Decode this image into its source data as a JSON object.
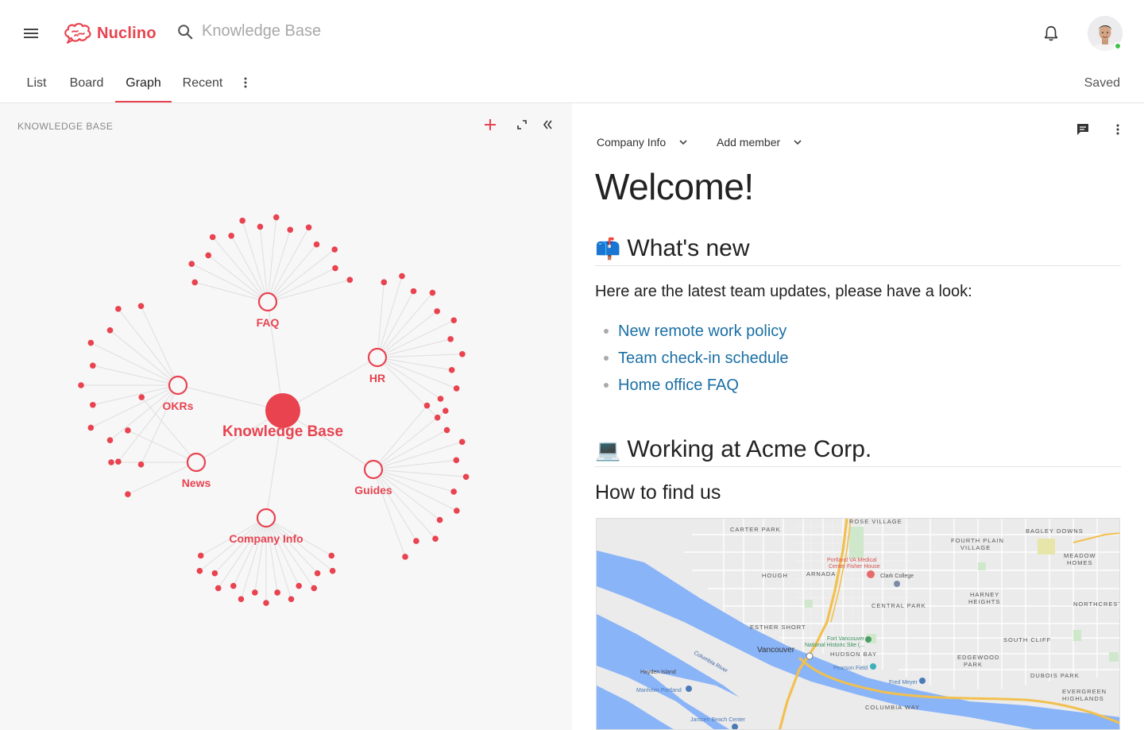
{
  "app": {
    "name": "Nuclino",
    "search_placeholder": "Knowledge Base",
    "status": "Saved",
    "brand_color": "#e8434f"
  },
  "tabs": [
    {
      "label": "List",
      "active": false
    },
    {
      "label": "Board",
      "active": false
    },
    {
      "label": "Graph",
      "active": true
    },
    {
      "label": "Recent",
      "active": false
    }
  ],
  "left_panel": {
    "title": "KNOWLEDGE BASE"
  },
  "graph": {
    "root_label": "Knowledge Base",
    "nodes": [
      {
        "label": "FAQ",
        "leaves": 14
      },
      {
        "label": "HR",
        "leaves": 12
      },
      {
        "label": "OKRs",
        "leaves": 11
      },
      {
        "label": "News",
        "leaves": 4
      },
      {
        "label": "Guides",
        "leaves": 12
      },
      {
        "label": "Company Info",
        "leaves": 15
      }
    ]
  },
  "document": {
    "workspace": "Company Info",
    "add_member": "Add member",
    "title": "Welcome!",
    "section1": {
      "emoji": "📫",
      "heading": "What's new",
      "intro": "Here are the latest team updates, please have a look:",
      "links": [
        "New remote work policy",
        "Team check-in schedule",
        "Home office FAQ"
      ]
    },
    "section2": {
      "emoji": "💻",
      "heading": "Working at Acme Corp.",
      "subheading": "How to find us"
    }
  },
  "map": {
    "labels": {
      "carter_park": "CARTER PARK",
      "rose_village": "ROSE VILLAGE",
      "bagley_downs": "BAGLEY DOWNS",
      "fourth_plain": "FOURTH PLAIN",
      "village": "VILLAGE",
      "meadow": "MEADOW",
      "homes": "HOMES",
      "hough": "HOUGH",
      "arnada": "ARNADA",
      "hospital": "Portland VA Medical",
      "hospital2": "Center Fisher House",
      "clark_college": "Clark College",
      "harney": "HARNEY",
      "heights": "HEIGHTS",
      "northcrest": "NORTHCREST",
      "central_park": "CENTRAL PARK",
      "esther_short": "ESTHER SHORT",
      "fort_vancouver": "Fort Vancouver",
      "historic": "National Historic Site (...",
      "south_cliff": "SOUTH CLIFF",
      "vancouver": "Vancouver",
      "hudson_bay": "HUDSON BAY",
      "edgewood": "EDGEWOOD",
      "park": "PARK",
      "pearson": "Pearson Field",
      "hayden": "Hayden Island",
      "manheim": "Manheim Portland",
      "dubois": "DUBOIS PARK",
      "fred_meyer": "Fred Meyer",
      "evergreen": "EVERGREEN",
      "highlands": "HIGHLANDS",
      "columbia_way": "COLUMBIA WAY",
      "jantzen": "Jantzen Beach Center",
      "columbia_river": "Columbia River"
    }
  }
}
